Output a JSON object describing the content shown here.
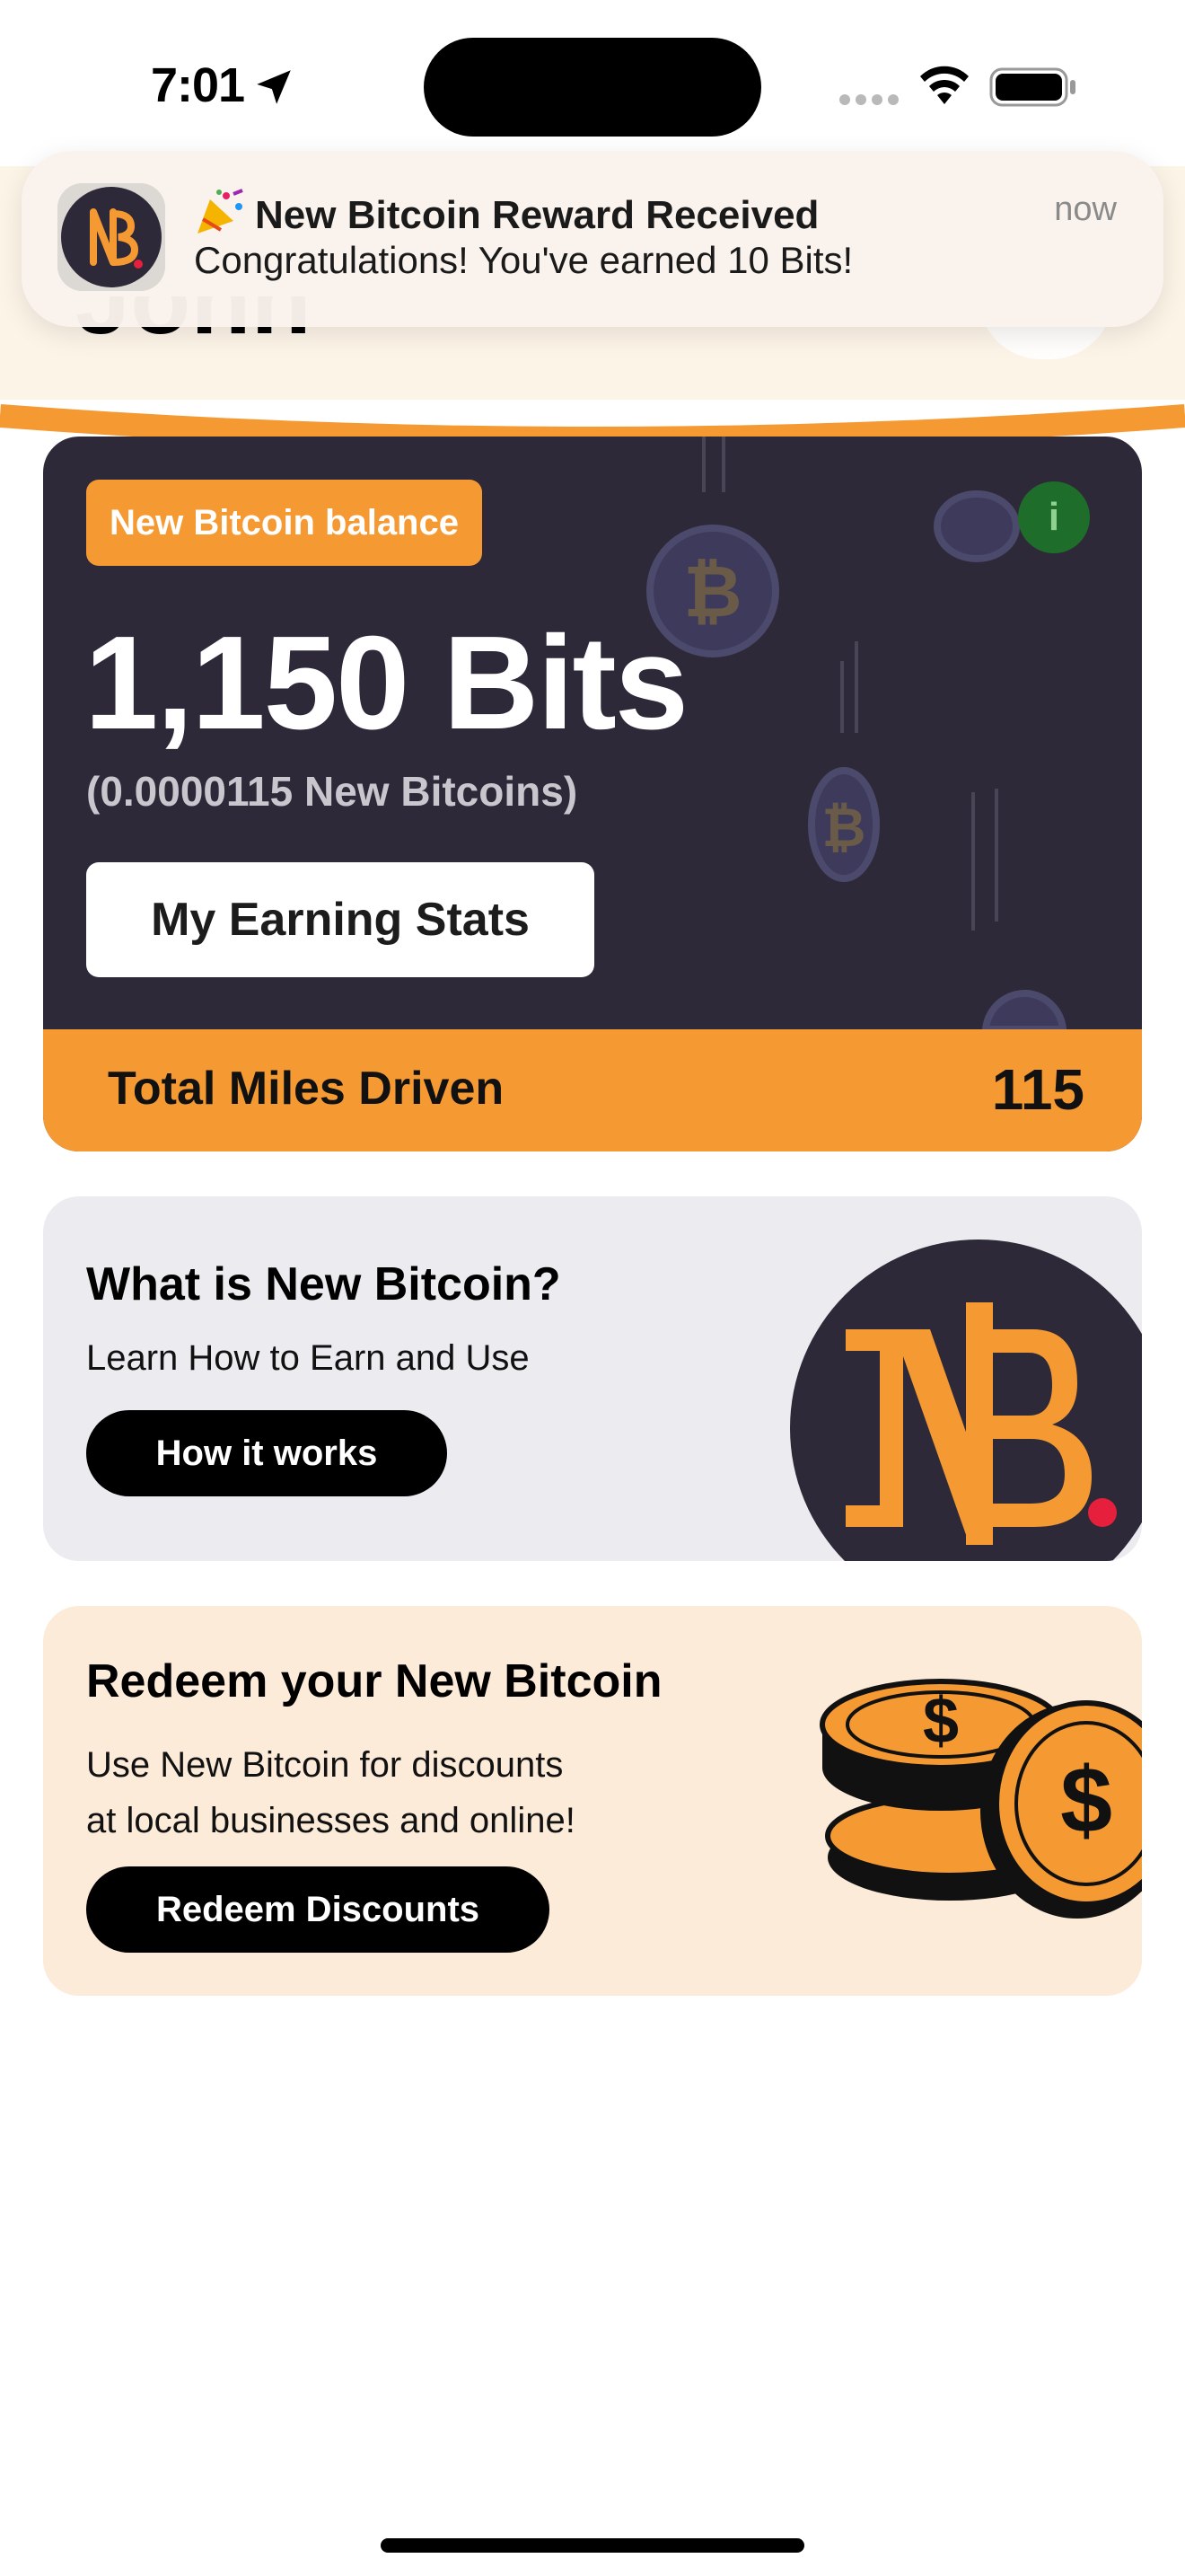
{
  "status_bar": {
    "time": "7:01"
  },
  "header": {
    "user_name": "John"
  },
  "notification": {
    "app_icon": "new-bitcoin-logo",
    "title": "New Bitcoin Reward Received",
    "body": "Congratulations! You've earned 10 Bits!",
    "time": "now"
  },
  "balance_card": {
    "badge": "New Bitcoin balance",
    "info_label": "i",
    "amount": "1,150 Bits",
    "btc_amount": "(0.0000115 New Bitcoins)",
    "stats_button": "My Earning Stats",
    "miles_label": "Total Miles Driven",
    "miles_value": "115"
  },
  "info_card": {
    "title": "What is New Bitcoin?",
    "subtitle": "Learn How to Earn and Use",
    "button": "How it works"
  },
  "redeem_card": {
    "title": "Redeem your New Bitcoin",
    "subtitle_line1": "Use New Bitcoin for discounts",
    "subtitle_line2": "at local businesses and online!",
    "button": "Redeem Discounts"
  },
  "colors": {
    "accent": "#f59a32",
    "card_dark": "#2e2938",
    "info_green": "#1f6d2a",
    "info_card_bg": "#ececf0",
    "redeem_card_bg": "#fdebd9"
  }
}
